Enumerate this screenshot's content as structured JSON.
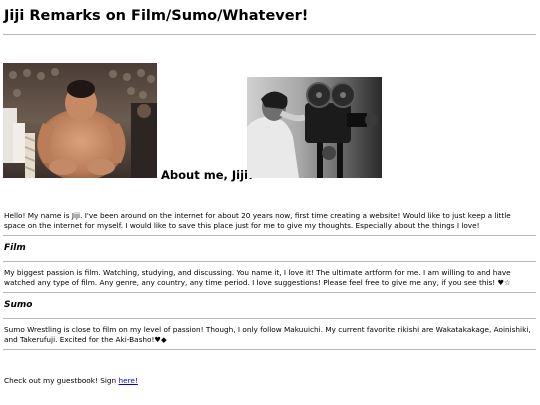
{
  "header": {
    "title": "Jiji Remarks on Film/Sumo/Whatever!"
  },
  "about": {
    "heading": "About me, Jiji!",
    "intro": "Hello! My name is Jiji. I've been around on the internet for about 20 years now, first time creating a website! Would like to just keep a little space on the internet for myself. I would like to save this place just for me to give my thoughts. Especially about the things I love!"
  },
  "film": {
    "heading": "Film",
    "body": "My biggest passion is film. Watching, studying, and discussing. You name it, I love it! The ultimate artform for me. I am willing to and have watched any type of film. Any genre, any country, any time period. I love suggestions! Please feel free to give me any, if you see this! ♥☆"
  },
  "sumo": {
    "heading": "Sumo",
    "body": "Sumo Wrestling is close to film on my level of passion! Though, I only follow Makuuichi. My current favorite rikishi are Wakatakakage, Aoinishiki, and Takerufuji. Excited for the Aki-Basho!♥◆"
  },
  "footer": {
    "guestbook_text": "Check out my guestbook! Sign ",
    "guestbook_link": "here!"
  }
}
